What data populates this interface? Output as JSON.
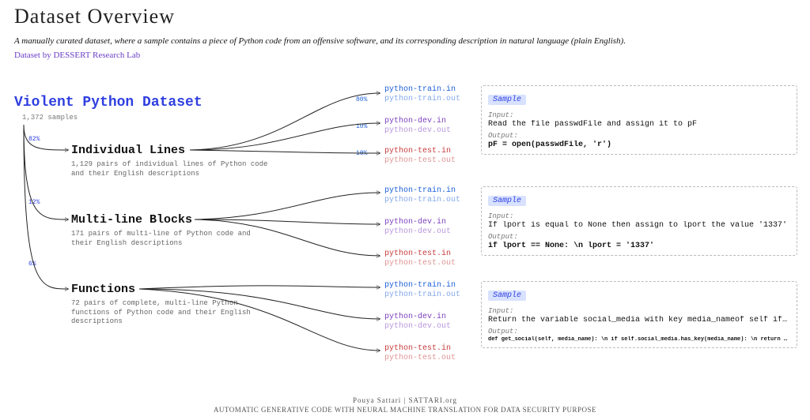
{
  "header": {
    "title": "Dataset Overview",
    "description": "A manually curated dataset, where a sample contains  a piece of Python code from an offensive software,  and its corresponding description in natural language (plain English).",
    "credit": "Dataset by DESSERT Research Lab"
  },
  "root": {
    "name": "Violent Python Dataset",
    "count": "1,372 samples"
  },
  "categories": [
    {
      "pct": "82%",
      "title": "Individual Lines",
      "desc": "1,129 pairs of individual lines of Python code and their English descriptions"
    },
    {
      "pct": "12%",
      "title": "Multi-line Blocks",
      "desc": "171 pairs of multi-line of Python code and their English descriptions"
    },
    {
      "pct": "6%",
      "title": "Functions",
      "desc": "72 pairs of complete, multi-line Python functions of Python code and their English descriptions"
    }
  ],
  "splits": {
    "train": {
      "pct": "80%",
      "in": "python-train.in",
      "out": "python-train.out"
    },
    "dev": {
      "pct": "10%",
      "in": "python-dev.in",
      "out": "python-dev.out"
    },
    "test": {
      "pct": "10%",
      "in": "python-test.in",
      "out": "python-test.out"
    }
  },
  "samples": [
    {
      "tag": "Sample",
      "input_label": "Input:",
      "input": "Read the file passwdFile and assign it to pF",
      "output_label": "Output:",
      "output": "pF = open(passwdFile, 'r')"
    },
    {
      "tag": "Sample",
      "input_label": "Input:",
      "input": "If lport is equal to None then assign to lport the value '1337'",
      "output_label": "Output:",
      "output": "if lport == None: \\n      lport = '1337'"
    },
    {
      "tag": "Sample",
      "input_label": "Input:",
      "input": "Return the variable social_media with key media_nameof self if it exists",
      "output_label": "Output:",
      "output": "def get_social(self, media_name): \\n   if self.social_media.has_key(media_name): \\n   return self.social_media[media_name] \\n"
    }
  ],
  "footer": {
    "line1": "Pouya Sattari  |  SATTARI.org",
    "line2": "AUTOMATIC GENERATIVE CODE WITH NEURAL MACHINE TRANSLATION FOR DATA SECURITY PURPOSE"
  }
}
